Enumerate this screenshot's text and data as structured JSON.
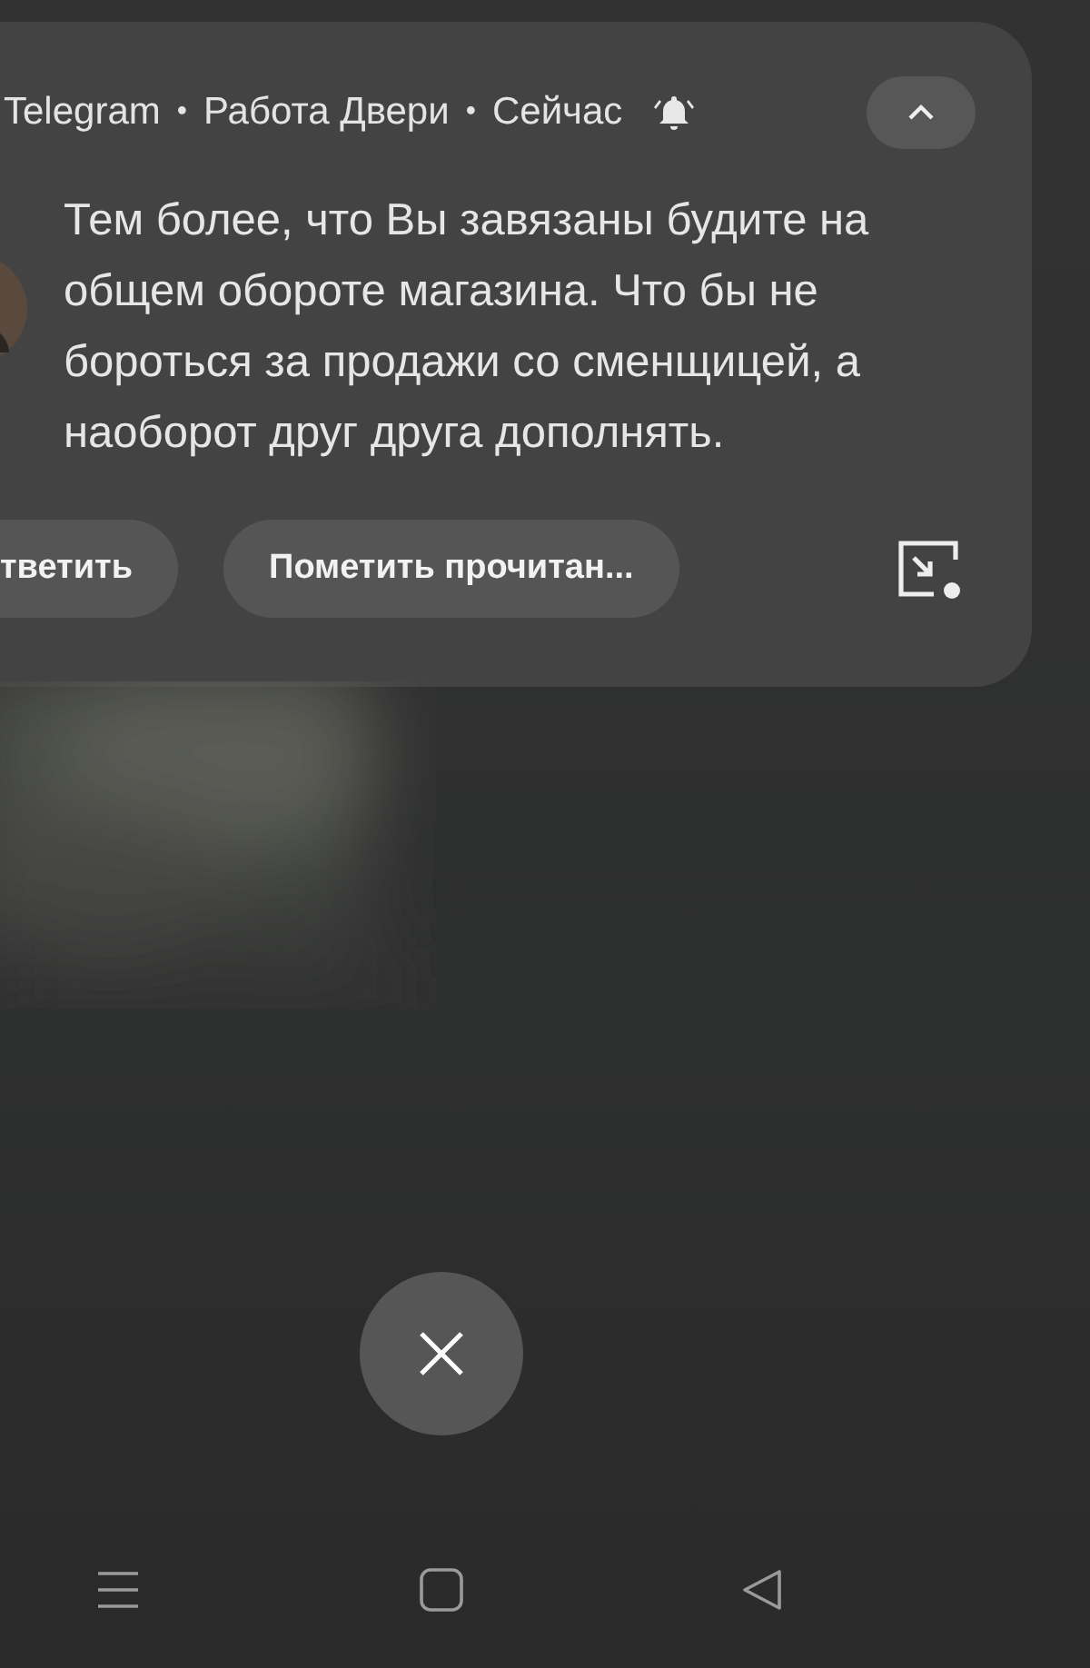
{
  "notification": {
    "header": [
      {
        "kind": "text",
        "text": "Telegram"
      },
      {
        "kind": "separator",
        "text": "•"
      },
      {
        "kind": "text",
        "text": "Работа Двери"
      },
      {
        "kind": "separator",
        "text": "•"
      },
      {
        "kind": "text",
        "text": "Сейчас"
      }
    ],
    "alerting": true,
    "expanded": true,
    "message": "Тем более, что Вы завязаны будите на общем обороте магазина. Что бы не бороться за продажи со сменщицей, а наоборот друг друга дополнять.",
    "actions": [
      {
        "label": "тветить"
      },
      {
        "label": "Пометить прочитан..."
      }
    ]
  },
  "nav_bar": {
    "buttons": [
      {
        "kind": "recents"
      },
      {
        "kind": "home"
      },
      {
        "kind": "back"
      }
    ]
  }
}
